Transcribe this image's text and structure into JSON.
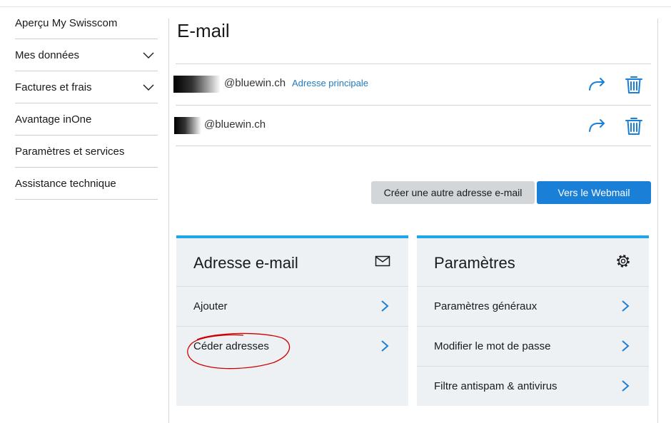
{
  "sidebar": {
    "items": [
      {
        "label": "Aperçu My Swisscom"
      },
      {
        "label": "Mes données"
      },
      {
        "label": "Factures et frais"
      },
      {
        "label": "Avantage inOne"
      },
      {
        "label": "Paramètres et services"
      },
      {
        "label": "Assistance technique"
      }
    ]
  },
  "main": {
    "title": "E-mail",
    "emails": [
      {
        "address_suffix": "@bluewin.ch",
        "badge": "Adresse principale"
      },
      {
        "address_suffix": "@bluewin.ch"
      }
    ],
    "buttons": {
      "create": "Créer une autre adresse e-mail",
      "webmail": "Vers le Webmail"
    }
  },
  "cards": {
    "email": {
      "title": "Adresse e-mail",
      "icon": "envelope-icon",
      "items": [
        {
          "label": "Ajouter"
        },
        {
          "label": "Céder adresses"
        }
      ]
    },
    "settings": {
      "title": "Paramètres",
      "icon": "gear-icon",
      "items": [
        {
          "label": "Paramètres généraux"
        },
        {
          "label": "Modifier le mot de passe"
        },
        {
          "label": "Filtre antispam & antivirus"
        }
      ]
    }
  },
  "colors": {
    "accent": "#1a7fd6",
    "card_border": "#1ea6ea",
    "card_bg": "#eef1f4",
    "annotation": "#cc0000"
  }
}
